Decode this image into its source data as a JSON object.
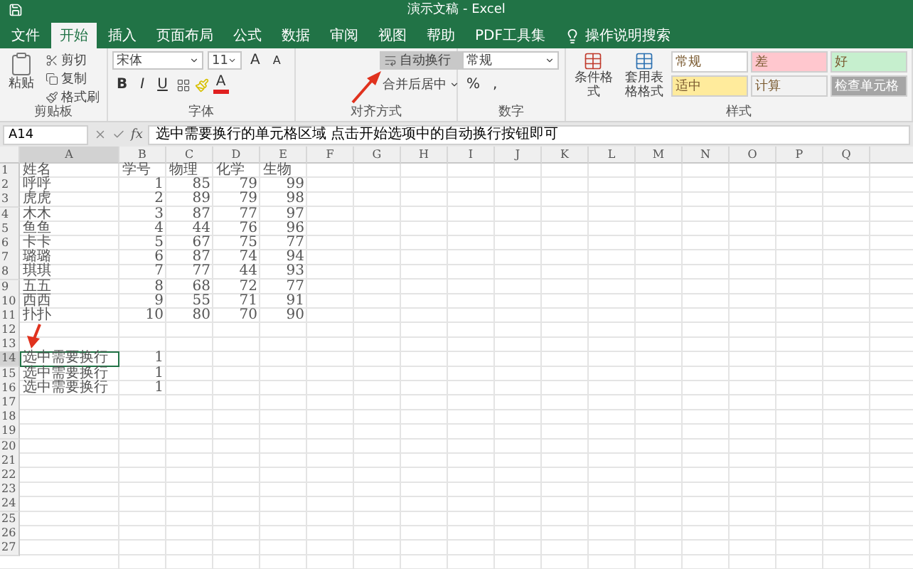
{
  "window": {
    "title": "演示文稿 - Excel"
  },
  "tabs": [
    {
      "label": "文件",
      "selected": false
    },
    {
      "label": "开始",
      "selected": true
    },
    {
      "label": "插入",
      "selected": false
    },
    {
      "label": "页面布局",
      "selected": false
    },
    {
      "label": "公式",
      "selected": false
    },
    {
      "label": "数据",
      "selected": false
    },
    {
      "label": "审阅",
      "selected": false
    },
    {
      "label": "视图",
      "selected": false
    },
    {
      "label": "帮助",
      "selected": false
    },
    {
      "label": "PDF工具集",
      "selected": false
    }
  ],
  "tell_me": "操作说明搜索",
  "ribbon": {
    "clipboard": {
      "label": "剪贴板",
      "paste": "粘贴",
      "items": [
        "剪切",
        "复制",
        "格式刷"
      ]
    },
    "font": {
      "label": "字体",
      "font_name": "宋体",
      "font_size": "11",
      "grow": "A",
      "shrink": "A",
      "bold": "B",
      "italic": "I",
      "underline": "U",
      "font_color": "A"
    },
    "alignment": {
      "label": "对齐方式",
      "wrap": {
        "label": "自动换行",
        "selected": true
      },
      "merge": "合并后居中"
    },
    "number": {
      "label": "数字",
      "format": "常规",
      "percent": "%",
      "comma": ","
    },
    "styles": {
      "label": "样式",
      "conditional": "条件格式",
      "table": "套用表格格式",
      "cells": [
        {
          "label": "常规",
          "color": "#ffffff"
        },
        {
          "label": "差",
          "color": "#ffc7ce"
        },
        {
          "label": "好",
          "color": "#c6efce"
        },
        {
          "label": "适中",
          "color": "#ffeb9c"
        },
        {
          "label": "计算",
          "color": "#f2f2f2"
        },
        {
          "label": "检查单元格",
          "color": "#a5a5a5"
        }
      ]
    }
  },
  "formula_bar": {
    "name_box": "A14",
    "fx": "fx",
    "content": "选中需要换行的单元格区域 点击开始选项中的自动换行按钮即可"
  },
  "sheet": {
    "columns": [
      {
        "label": "A",
        "selected": true
      },
      {
        "label": "B",
        "selected": false
      },
      {
        "label": "C",
        "selected": false
      },
      {
        "label": "D",
        "selected": false
      },
      {
        "label": "E",
        "selected": false
      },
      {
        "label": "F",
        "selected": false
      },
      {
        "label": "G",
        "selected": false
      },
      {
        "label": "H",
        "selected": false
      },
      {
        "label": "I",
        "selected": false
      },
      {
        "label": "J",
        "selected": false
      },
      {
        "label": "K",
        "selected": false
      },
      {
        "label": "L",
        "selected": false
      },
      {
        "label": "M",
        "selected": false
      },
      {
        "label": "N",
        "selected": false
      },
      {
        "label": "O",
        "selected": false
      },
      {
        "label": "P",
        "selected": false
      },
      {
        "label": "Q",
        "selected": false
      }
    ],
    "header_row": {
      "number": "1",
      "cells": [
        "姓名",
        "学号",
        "物理",
        "化学",
        "生物"
      ]
    },
    "rows": [
      {
        "number": "2",
        "selected": false,
        "cells": [
          "呼呼",
          "1",
          "85",
          "79",
          "99"
        ]
      },
      {
        "number": "3",
        "selected": false,
        "cells": [
          "虎虎",
          "2",
          "89",
          "79",
          "98"
        ]
      },
      {
        "number": "4",
        "selected": false,
        "cells": [
          "木木",
          "3",
          "87",
          "77",
          "97"
        ]
      },
      {
        "number": "5",
        "selected": false,
        "cells": [
          "鱼鱼",
          "4",
          "44",
          "76",
          "96"
        ]
      },
      {
        "number": "6",
        "selected": false,
        "cells": [
          "卡卡",
          "5",
          "67",
          "75",
          "77"
        ]
      },
      {
        "number": "7",
        "selected": false,
        "cells": [
          "璐璐",
          "6",
          "87",
          "74",
          "94"
        ]
      },
      {
        "number": "8",
        "selected": false,
        "cells": [
          "琪琪",
          "7",
          "77",
          "44",
          "93"
        ]
      },
      {
        "number": "9",
        "selected": false,
        "cells": [
          "五五",
          "8",
          "68",
          "72",
          "77"
        ]
      },
      {
        "number": "10",
        "selected": false,
        "cells": [
          "西西",
          "9",
          "55",
          "71",
          "91"
        ]
      },
      {
        "number": "11",
        "selected": false,
        "cells": [
          "扑扑",
          "10",
          "80",
          "70",
          "90"
        ]
      },
      {
        "number": "12",
        "selected": false,
        "cells": []
      },
      {
        "number": "13",
        "selected": false,
        "cells": []
      },
      {
        "number": "14",
        "selected": true,
        "cells": [
          "选中需要换行",
          "1"
        ]
      },
      {
        "number": "15",
        "selected": false,
        "cells": [
          "选中需要换行",
          "1"
        ]
      },
      {
        "number": "16",
        "selected": false,
        "cells": [
          "选中需要换行",
          "1"
        ]
      },
      {
        "number": "17",
        "selected": false,
        "cells": []
      },
      {
        "number": "18",
        "selected": false,
        "cells": []
      },
      {
        "number": "19",
        "selected": false,
        "cells": []
      },
      {
        "number": "20",
        "selected": false,
        "cells": []
      },
      {
        "number": "21",
        "selected": false,
        "cells": []
      },
      {
        "number": "22",
        "selected": false,
        "cells": []
      },
      {
        "number": "23",
        "selected": false,
        "cells": []
      },
      {
        "number": "24",
        "selected": false,
        "cells": []
      },
      {
        "number": "25",
        "selected": false,
        "cells": []
      },
      {
        "number": "26",
        "selected": false,
        "cells": []
      },
      {
        "number": "27",
        "selected": false,
        "cells": []
      }
    ]
  }
}
